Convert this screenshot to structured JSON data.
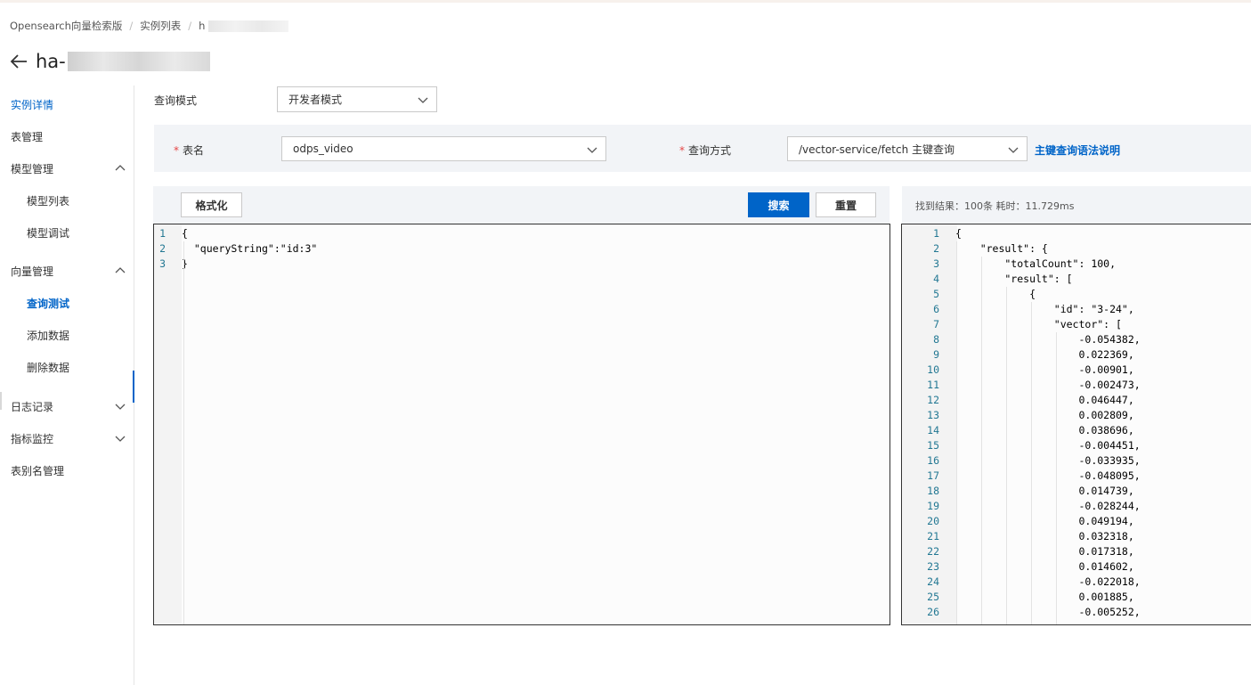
{
  "breadcrumb": {
    "items": [
      "Opensearch向量检索版",
      "实例列表",
      "h"
    ]
  },
  "page": {
    "title": "ha-"
  },
  "sidebar": {
    "items": [
      {
        "label": "实例详情"
      },
      {
        "label": "表管理"
      },
      {
        "label": "模型管理"
      },
      {
        "label": "模型列表"
      },
      {
        "label": "模型调试"
      },
      {
        "label": "向量管理"
      },
      {
        "label": "查询测试"
      },
      {
        "label": "添加数据"
      },
      {
        "label": "删除数据"
      },
      {
        "label": "日志记录"
      },
      {
        "label": "指标监控"
      },
      {
        "label": "表别名管理"
      }
    ]
  },
  "query_mode": {
    "label": "查询模式",
    "value": "开发者模式"
  },
  "filters": {
    "table_label": "表名",
    "table_value": "odps_video",
    "method_label": "查询方式",
    "method_value": "/vector-service/fetch 主键查询",
    "syntax_link": "主键查询语法说明",
    "required_mark": "*"
  },
  "toolbar": {
    "format_label": "格式化",
    "search_label": "搜索",
    "reset_label": "重置",
    "result_info": "找到结果：100条  耗时：11.729ms"
  },
  "query_editor": {
    "lines": [
      "{",
      "  \"queryString\":\"id:3\"",
      "}"
    ]
  },
  "result_editor": {
    "lines": [
      "{",
      "    \"result\": {",
      "        \"totalCount\": 100,",
      "        \"result\": [",
      "            {",
      "                \"id\": \"3-24\",",
      "                \"vector\": [",
      "                    -0.054382,",
      "                    0.022369,",
      "                    -0.00901,",
      "                    -0.002473,",
      "                    0.046447,",
      "                    0.002809,",
      "                    0.038696,",
      "                    -0.004451,",
      "                    -0.033935,",
      "                    -0.048095,",
      "                    0.014739,",
      "                    -0.028244,",
      "                    0.049194,",
      "                    0.032318,",
      "                    0.017318,",
      "                    0.014602,",
      "                    -0.022018,",
      "                    0.001885,",
      "                    -0.005252,"
    ]
  },
  "colors": {
    "accent": "#0064c8",
    "required": "#e54545",
    "panel_bg": "#f2f4f7"
  }
}
